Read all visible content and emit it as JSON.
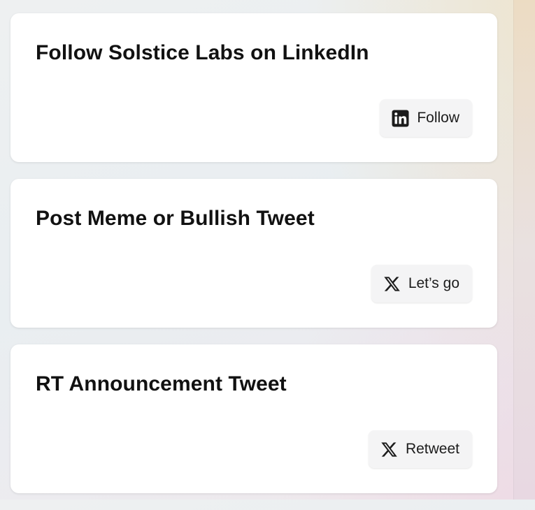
{
  "tasks": [
    {
      "title": "Follow Solstice Labs on LinkedIn",
      "button_label": "Follow",
      "button_icon": "linkedin-icon"
    },
    {
      "title": "Post Meme or Bullish Tweet",
      "button_label": "Let’s go",
      "button_icon": "x-logo-icon"
    },
    {
      "title": "RT Announcement Tweet",
      "button_label": "Retweet",
      "button_icon": "x-logo-icon"
    }
  ],
  "colors": {
    "card_background": "#ffffff",
    "button_background": "#f4f4f5",
    "text": "#111111"
  }
}
